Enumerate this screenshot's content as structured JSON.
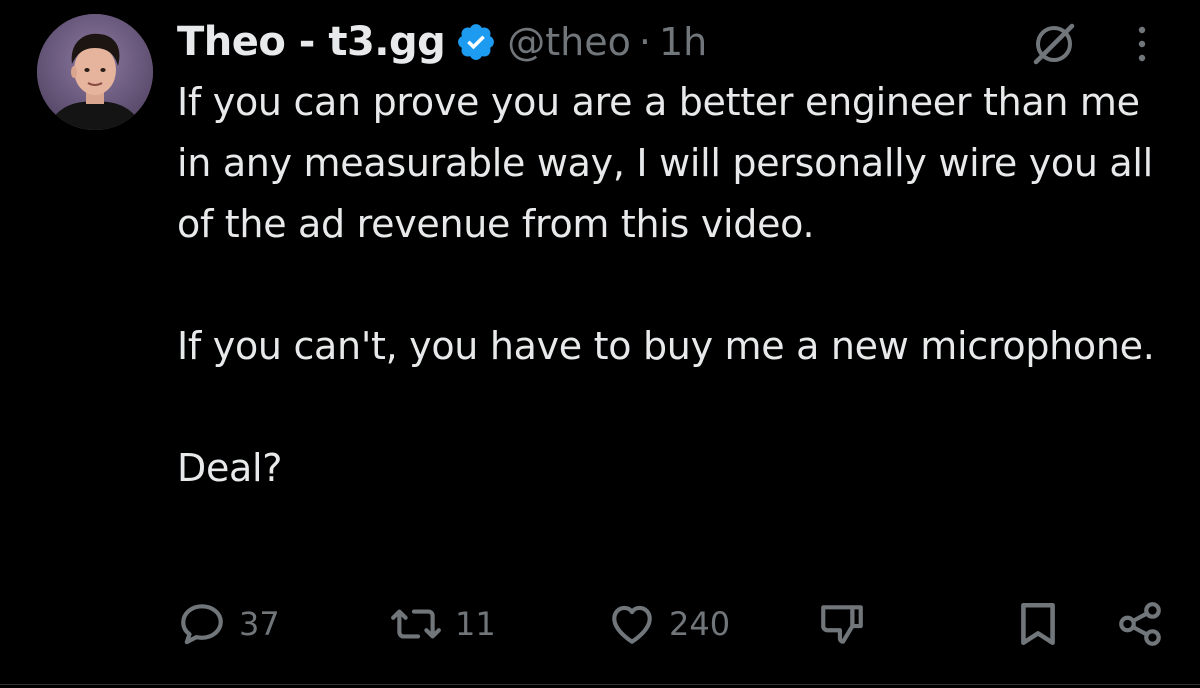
{
  "tweet": {
    "display_name": "Theo - t3.gg",
    "handle": "@theo",
    "separator": "·",
    "time": "1h",
    "paragraphs": [
      "If you can prove you are a better engineer than me in any measurable way, I will personally wire you all of the ad revenue from this video.",
      "If you can't, you have to buy me a new microphone.",
      "Deal?"
    ]
  },
  "actions": {
    "replies": "37",
    "retweets": "11",
    "likes": "240"
  },
  "icons": {
    "verified": "verified-badge-icon",
    "grok": "grok-icon",
    "more": "more-vertical-icon",
    "reply": "reply-icon",
    "retweet": "retweet-icon",
    "like": "heart-icon",
    "dislike": "thumbs-down-icon",
    "bookmark": "bookmark-icon",
    "share": "share-icon"
  },
  "colors": {
    "background": "#000000",
    "text": "#e7e9ea",
    "muted": "#71767b",
    "verified": "#1d9bf0"
  }
}
